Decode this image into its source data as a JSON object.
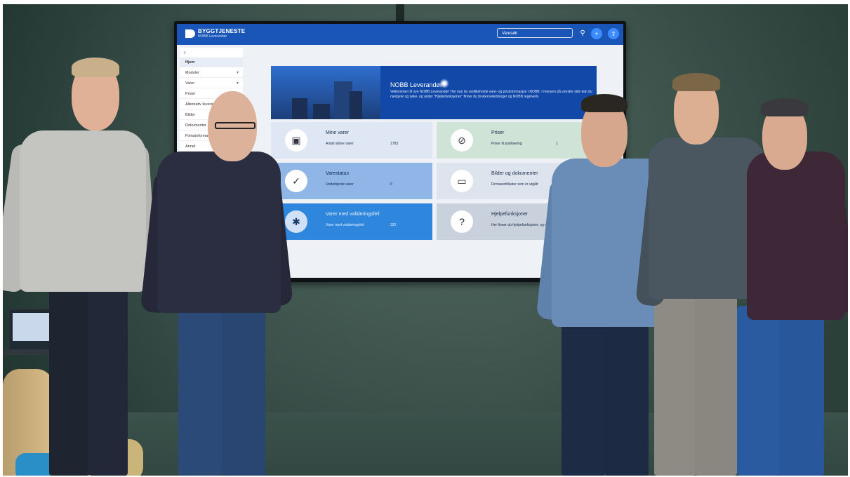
{
  "screen": {
    "brand": {
      "name": "BYGGTJENESTE",
      "sub": "NOBB Leverandør"
    },
    "search": {
      "placeholder": "Varesøk"
    },
    "sidebar": {
      "back": "‹",
      "items": [
        {
          "label": "Hjem",
          "has_chevron": false,
          "active": true
        },
        {
          "label": "Moduler",
          "has_chevron": true
        },
        {
          "label": "Varer",
          "has_chevron": true
        },
        {
          "label": "Priser",
          "has_chevron": false
        },
        {
          "label": "Alternativ leverandør",
          "has_chevron": false
        },
        {
          "label": "Bilder",
          "has_chevron": false
        },
        {
          "label": "Dokumenter",
          "has_chevron": false
        },
        {
          "label": "Firmainformasjon",
          "has_chevron": false
        },
        {
          "label": "Annet",
          "has_chevron": false
        }
      ]
    },
    "hero": {
      "title": "NOBB Leverandør",
      "text": "Velkommen til nye NOBB Leverandør! Her kan du vedlikeholde vare- og prisinformasjon i NOBB. I menyen på venstre side kan du navigere og søke, og under \"Hjelpefunksjoner\" finner du brukerveiledninger og NOBB regelverk."
    },
    "cards": [
      {
        "title": "Mine varer",
        "sub": "Antall aktive varer",
        "value": "1783",
        "icon": "cube-icon",
        "bg": "#dfe7f4",
        "icon_bg": "#ffffff",
        "icon_color": "#334",
        "text_color": "#1a2b4a"
      },
      {
        "title": "Priser",
        "sub": "Priser til publisering",
        "value": "1",
        "icon": "no-price-icon",
        "bg": "#cfe3d6",
        "icon_bg": "#ffffff",
        "icon_color": "#334",
        "text_color": "#1a2b4a"
      },
      {
        "title": "Varestatus",
        "sub": "Underkjente varer",
        "value": "0",
        "icon": "check-circle-icon",
        "bg": "#8fb6e6",
        "icon_bg": "#ffffff",
        "icon_color": "#334",
        "text_color": "#0e2550"
      },
      {
        "title": "Bilder og dokumenter",
        "sub": "Firmasertifikater som er utgått",
        "value": "",
        "icon": "folder-icon",
        "bg": "#dde4ee",
        "icon_bg": "#ffffff",
        "icon_color": "#334",
        "text_color": "#1a2b4a"
      },
      {
        "title": "Varer med valideringsfeil",
        "sub": "Varer med valideringsfeil",
        "value": "320",
        "icon": "bug-icon",
        "bg": "#2f86dd",
        "icon_bg": "#cfe0f7",
        "icon_color": "#1b3a6a",
        "text_color": "#e8f1ff"
      },
      {
        "title": "Hjelpefunksjoner",
        "sub": "Her finner du hjelpefunksjoner, og regelverk",
        "value": "",
        "icon": "help-icon",
        "bg": "#c9d1dc",
        "icon_bg": "#ffffff",
        "icon_color": "#222",
        "text_color": "#1a2b4a"
      }
    ]
  }
}
